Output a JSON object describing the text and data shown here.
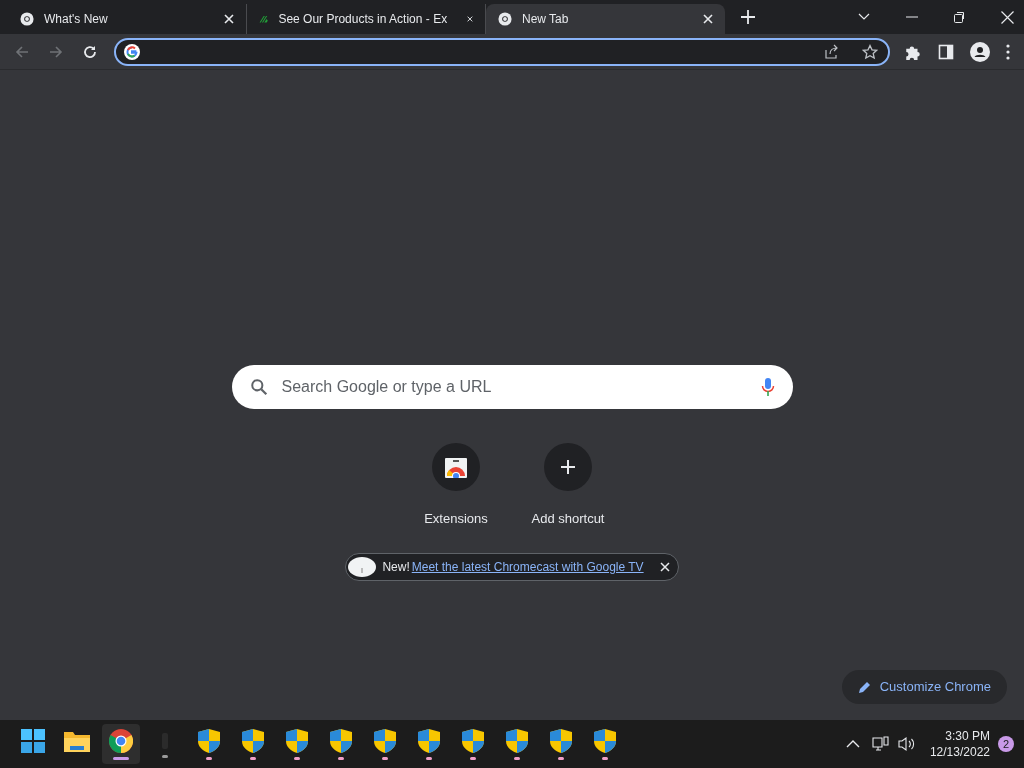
{
  "tabs": [
    {
      "title": "What's New",
      "kind": "chrome",
      "selected": false
    },
    {
      "title": "See Our Products in Action - Ex",
      "kind": "stripes",
      "selected": false
    },
    {
      "title": "New Tab",
      "kind": "chrome",
      "selected": true
    }
  ],
  "search": {
    "placeholder": "Search Google or type a URL"
  },
  "shortcuts": [
    {
      "label": "Extensions",
      "kind": "webstore"
    },
    {
      "label": "Add shortcut",
      "kind": "add"
    }
  ],
  "promo": {
    "text": "New!",
    "link": "Meet the latest Chromecast with Google TV"
  },
  "customize_button": "Customize Chrome",
  "taskbar": {
    "apps": [
      {
        "kind": "start",
        "selected": false
      },
      {
        "kind": "folder",
        "selected": false
      },
      {
        "kind": "chrome",
        "selected": true
      },
      {
        "kind": "blank",
        "selected": false
      },
      {
        "kind": "shield",
        "selected": false
      },
      {
        "kind": "shield",
        "selected": false
      },
      {
        "kind": "shield",
        "selected": false
      },
      {
        "kind": "shield",
        "selected": false
      },
      {
        "kind": "shield",
        "selected": false
      },
      {
        "kind": "shield",
        "selected": false
      },
      {
        "kind": "shield",
        "selected": false
      },
      {
        "kind": "shield",
        "selected": false
      },
      {
        "kind": "shield",
        "selected": false
      },
      {
        "kind": "shield",
        "selected": false
      }
    ],
    "time": "3:30 PM",
    "date": "12/13/2022",
    "notifications": "2"
  }
}
